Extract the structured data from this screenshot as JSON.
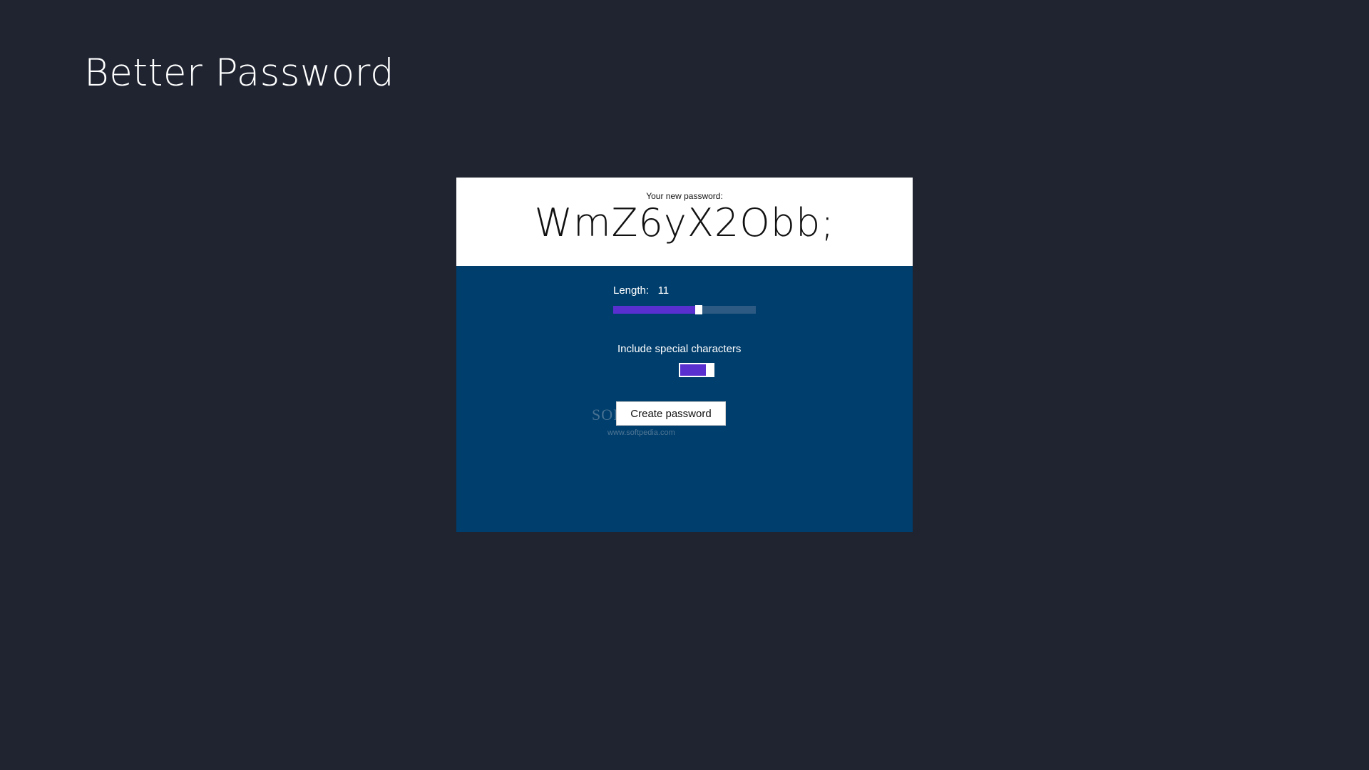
{
  "app": {
    "title": "Better Password"
  },
  "result": {
    "label": "Your new password:",
    "password": "WmZ6yX2Obb;"
  },
  "length": {
    "label": "Length:",
    "value": "11",
    "slider_fraction": 0.6
  },
  "special_chars": {
    "label": "Include special characters",
    "enabled": true
  },
  "actions": {
    "create_label": "Create password"
  },
  "watermark": {
    "text": "SOFTPEDIA",
    "url": "www.softpedia.com"
  },
  "colors": {
    "background": "#1f2430",
    "panel": "#003e6d",
    "accent": "#5a2fd0",
    "slider_track": "#2d5a82",
    "result_bg": "#ffffff"
  }
}
